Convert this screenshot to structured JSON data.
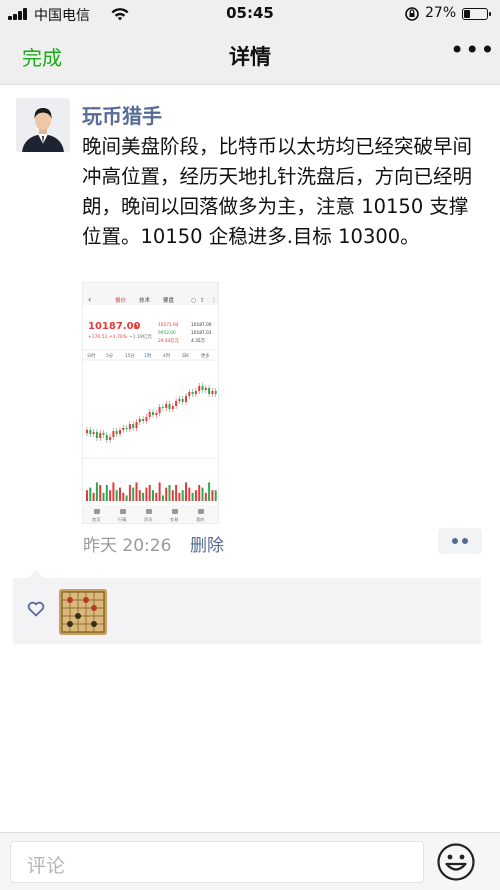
{
  "status_bar": {
    "carrier": "中国电信",
    "time": "05:45",
    "battery": "27%",
    "battery_level": 0.27
  },
  "nav": {
    "done_label": "完成",
    "title": "详情",
    "more_icon": "more-dots-icon"
  },
  "post": {
    "author": "玩币猎手",
    "text": "晚间美盘阶段，比特币以太坊均已经突破早间冲高位置，经历天地扎针洗盘后，方向已经明朗，晚间以回落做多为主，注意 10150 支撑位置。10150 企稳进多.目标 10300。",
    "time": "昨天 20:26",
    "delete_label": "删除"
  },
  "image": {
    "tabs": [
      "报价",
      "技术",
      "要盘"
    ],
    "price": "10187.00",
    "price_up_marker": "▲",
    "change": "+170.51  +1.70%",
    "volume_text": "~1.19亿元",
    "stats": [
      [
        "10271.94",
        "10187.00"
      ],
      [
        "9952.00",
        "10187.01"
      ],
      [
        "29.44亿元",
        "4.35万"
      ]
    ],
    "period_tabs": [
      "分时",
      "5分",
      "15分",
      "1时",
      "4时",
      "日K",
      "更多"
    ],
    "bottom_tabs": [
      "首页",
      "行情",
      "资讯",
      "交易",
      "我的"
    ]
  },
  "colors": {
    "wechat_green": "#1aad19",
    "link_blue": "#576b95",
    "up_red": "#e63a3a",
    "down_green": "#2fa84f"
  },
  "comment": {
    "placeholder": "评论",
    "emoji_icon": "smiley-icon"
  }
}
